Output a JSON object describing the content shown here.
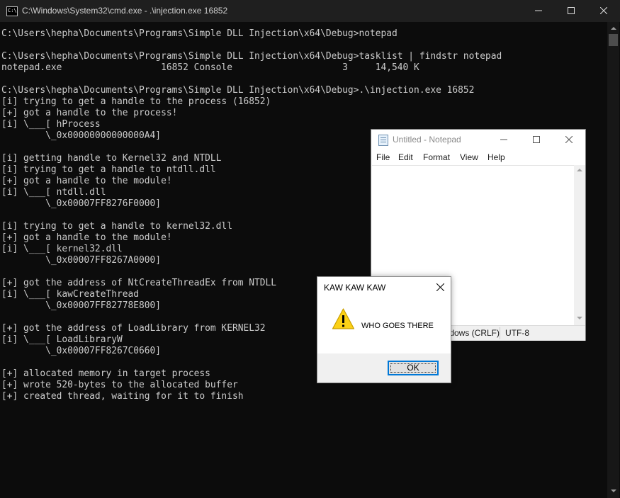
{
  "cmd": {
    "title": "C:\\Windows\\System32\\cmd.exe - .\\injection.exe  16852",
    "lines": [
      "C:\\Users\\hepha\\Documents\\Programs\\Simple DLL Injection\\x64\\Debug>notepad",
      "",
      "C:\\Users\\hepha\\Documents\\Programs\\Simple DLL Injection\\x64\\Debug>tasklist | findstr notepad",
      "notepad.exe                  16852 Console                    3     14,540 K",
      "",
      "C:\\Users\\hepha\\Documents\\Programs\\Simple DLL Injection\\x64\\Debug>.\\injection.exe 16852",
      "[i] trying to get a handle to the process (16852)",
      "[+] got a handle to the process!",
      "[i] \\___[ hProcess",
      "        \\_0x00000000000000A4]",
      "",
      "[i] getting handle to Kernel32 and NTDLL",
      "[i] trying to get a handle to ntdll.dll",
      "[+] got a handle to the module!",
      "[i] \\___[ ntdll.dll",
      "        \\_0x00007FF8276F0000]",
      "",
      "[i] trying to get a handle to kernel32.dll",
      "[+] got a handle to the module!",
      "[i] \\___[ kernel32.dll",
      "        \\_0x00007FF8267A0000]",
      "",
      "[+] got the address of NtCreateThreadEx from NTDLL",
      "[i] \\___[ kawCreateThread",
      "        \\_0x00007FF82778E800]",
      "",
      "[+] got the address of LoadLibrary from KERNEL32",
      "[i] \\___[ LoadLibraryW",
      "        \\_0x00007FF8267C0660]",
      "",
      "[+] allocated memory in target process",
      "[+] wrote 520-bytes to the allocated buffer",
      "[+] created thread, waiting for it to finish"
    ]
  },
  "notepad": {
    "title": "Untitled - Notepad",
    "menu": [
      "File",
      "Edit",
      "Format",
      "View",
      "Help"
    ],
    "status_eol": "Windows (CRLF)",
    "status_encoding": "UTF-8"
  },
  "messagebox": {
    "title": "KAW KAW KAW",
    "message": "WHO GOES THERE",
    "ok_label": "OK",
    "icon": "warning-icon"
  },
  "colors": {
    "console_bg": "#0c0c0c",
    "console_text": "#cccccc",
    "accent": "#0078d7",
    "warning": "#fcd116"
  }
}
